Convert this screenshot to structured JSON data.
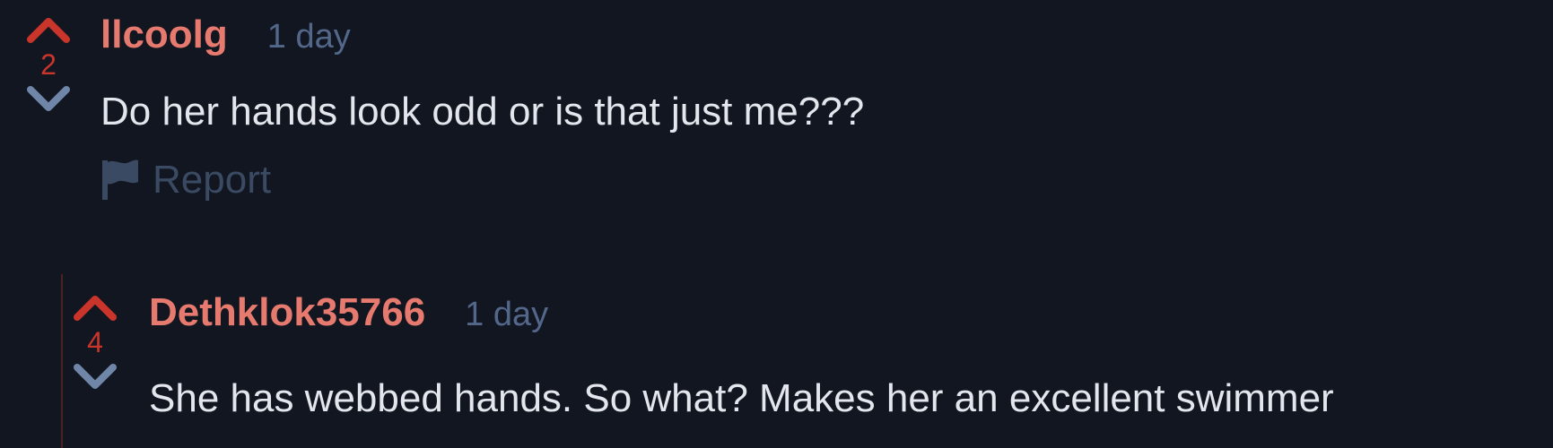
{
  "colors": {
    "background": "#121620",
    "upvote_active": "#c9352a",
    "downvote": "#6f86a8",
    "username": "#e77a6f",
    "timestamp": "#53678a",
    "body_text": "#e3e6ec",
    "report": "#3a4a63",
    "thread_line": "#4a2222"
  },
  "comments": [
    {
      "score": "2",
      "username": "llcoolg",
      "timestamp": "1 day",
      "body": "Do her hands look odd or is that just me???",
      "report_label": "Report",
      "upvote_icon": "chevron-up-icon",
      "downvote_icon": "chevron-down-icon",
      "report_icon": "flag-icon"
    },
    {
      "score": "4",
      "username": "Dethklok35766",
      "timestamp": "1 day",
      "body": "She has webbed hands. So what? Makes her an excellent swimmer",
      "upvote_icon": "chevron-up-icon",
      "downvote_icon": "chevron-down-icon"
    }
  ]
}
